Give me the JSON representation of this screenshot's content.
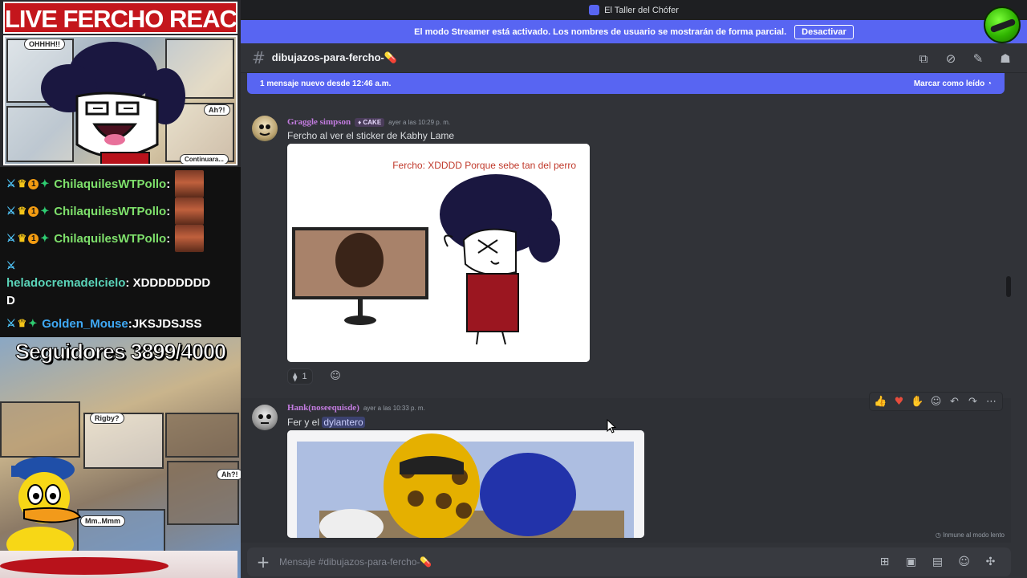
{
  "stream": {
    "title": "LIVE FERCHO REACTION",
    "comic_bubbles": [
      "OHHHH!!",
      "Ah?!",
      "Continuara..."
    ],
    "comic_bottom_bubbles": [
      "Rigby?",
      "Ah?!",
      "Mm..Mmm"
    ],
    "followers": "Seguidores 3899/4000",
    "chat": [
      {
        "user": "ChilaquilesWTPollo",
        "sep": ":",
        "message": ""
      },
      {
        "user": "ChilaquilesWTPollo",
        "sep": ":",
        "message": ""
      },
      {
        "user": "ChilaquilesWTPollo",
        "sep": ":",
        "message": ""
      }
    ],
    "chat_multi": {
      "user": "heladocremadelcielo",
      "sep": ":",
      "message": " XDDDDDDDD",
      "wrap": "D"
    },
    "chat_last": {
      "user": "Golden_Mouse",
      "sep": ":",
      "message": " JKSJDSJSS"
    },
    "badge_num": "1"
  },
  "window": {
    "title": "El Taller del Chófer"
  },
  "streamer_banner": {
    "text": "El modo Streamer está activado. Los nombres de usuario se mostrarán de forma parcial.",
    "button": "Desactivar"
  },
  "channel": {
    "hash": "#",
    "name": "dibujazos-para-fercho-💊"
  },
  "new_messages": {
    "text": "1 mensaje nuevo desde 12:46 a.m.",
    "mark_read": "Marcar como leído"
  },
  "messages": [
    {
      "author": "Graggle simpson",
      "badge": "CAKE",
      "timestamp": "ayer a las 10:29 p. m.",
      "text": "Fercho al ver el sticker de Kabhy Lame",
      "image_caption": "Fercho: XDDDD Porque sebe tan del perro",
      "reaction_count": "1"
    },
    {
      "author": "Hank(noseequisde)",
      "timestamp": "ayer a las 10:33 p. m.",
      "text_before": "Fer y el ",
      "mention": "dylantero"
    }
  ],
  "slow_mode": "Inmune al modo lento",
  "composer": {
    "placeholder": "Mensaje #dibujazos-para-fercho-💊"
  },
  "colors": {
    "brand": "#5865f2",
    "background": "#313338",
    "author": "#c37ce0"
  }
}
